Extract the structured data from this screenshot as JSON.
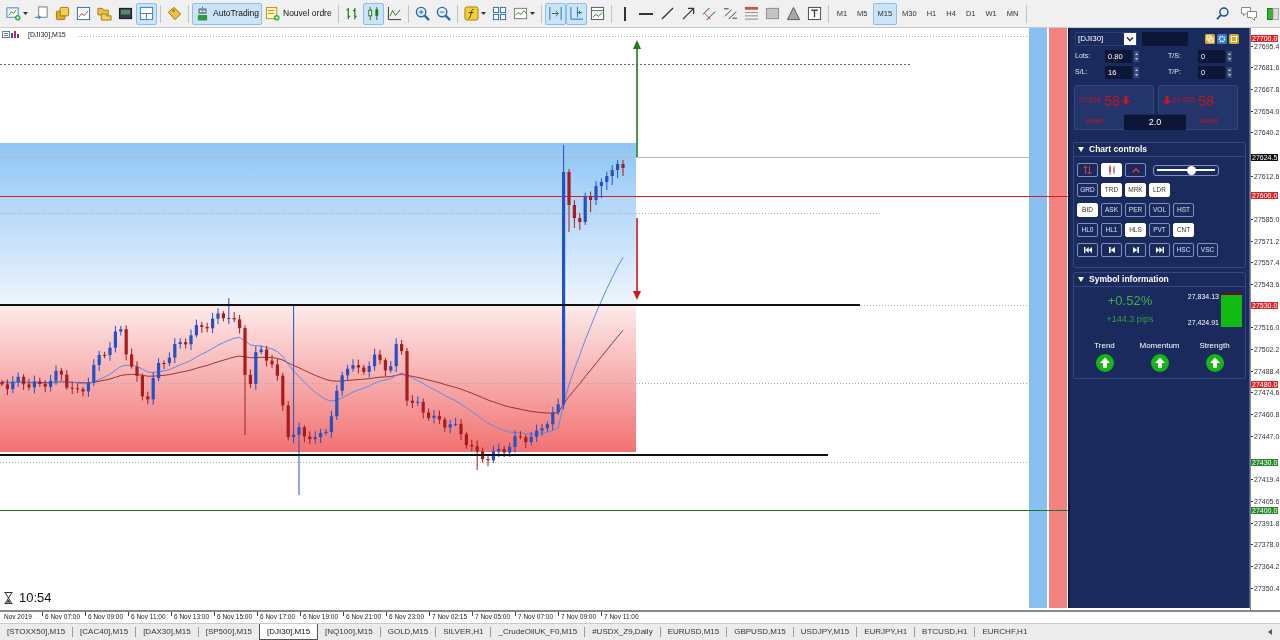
{
  "toolbar": {
    "buttons": [
      {
        "kind": "dropdown",
        "on": false
      },
      {
        "kind": "icon",
        "on": false
      },
      {
        "kind": "icon",
        "on": false
      },
      {
        "kind": "icon",
        "on": false
      },
      {
        "kind": "icon",
        "on": false
      },
      {
        "kind": "icon",
        "on": false
      },
      {
        "kind": "icon",
        "on": true
      },
      {
        "kind": "icon",
        "on": false
      },
      {
        "kind": "labeled",
        "label": "AutoTrading",
        "on": true
      },
      {
        "kind": "labeled",
        "label": "Nouvel ordre",
        "on": false
      },
      {
        "kind": "icon",
        "on": false
      },
      {
        "kind": "icon",
        "on": true
      },
      {
        "kind": "icon",
        "on": false
      },
      {
        "kind": "icon",
        "on": false
      },
      {
        "kind": "icon",
        "on": false
      },
      {
        "kind": "dropdown",
        "on": false
      },
      {
        "kind": "icon",
        "on": false
      },
      {
        "kind": "dropdown",
        "on": false
      },
      {
        "kind": "icon",
        "on": true
      },
      {
        "kind": "icon",
        "on": true
      },
      {
        "kind": "icon",
        "on": false
      },
      {
        "kind": "icon",
        "on": false
      },
      {
        "kind": "icon",
        "on": false
      },
      {
        "kind": "icon",
        "on": false
      },
      {
        "kind": "icon",
        "on": false
      },
      {
        "kind": "icon",
        "on": false
      },
      {
        "kind": "icon",
        "on": false
      },
      {
        "kind": "icon",
        "on": false
      },
      {
        "kind": "icon",
        "on": false
      },
      {
        "kind": "icon",
        "on": false
      },
      {
        "kind": "icon",
        "on": false
      }
    ],
    "timeframes": [
      {
        "label": "M1",
        "selected": false
      },
      {
        "label": "M5",
        "selected": false
      },
      {
        "label": "M15",
        "selected": true
      },
      {
        "label": "M30",
        "selected": false
      },
      {
        "label": "H1",
        "selected": false
      },
      {
        "label": "H4",
        "selected": false
      },
      {
        "label": "D1",
        "selected": false
      },
      {
        "label": "W1",
        "selected": false
      },
      {
        "label": "MN",
        "selected": false
      }
    ]
  },
  "chart": {
    "title": "[DJI30],M15",
    "clock": "10:54",
    "price_labels": [
      {
        "label": "27700.0",
        "color": "#d62828"
      },
      {
        "label": "27695.4"
      },
      {
        "label": "27681.6"
      },
      {
        "label": "27667.8"
      },
      {
        "label": "27654.0"
      },
      {
        "label": "27640.2"
      },
      {
        "label": "27624.5",
        "color": "#111111"
      },
      {
        "label": "27612.6"
      },
      {
        "label": "27600.0",
        "color": "#d62828"
      },
      {
        "label": "27585.0"
      },
      {
        "label": "27571.2"
      },
      {
        "label": "27557.4"
      },
      {
        "label": "27543.6"
      },
      {
        "label": "27530.0",
        "color": "#d62828"
      },
      {
        "label": "27516.0"
      },
      {
        "label": "27502.2"
      },
      {
        "label": "27488.4"
      },
      {
        "label": "27480.0",
        "color": "#d62828"
      },
      {
        "label": "27474.6"
      },
      {
        "label": "27460.8"
      },
      {
        "label": "27447.0"
      },
      {
        "label": "27430.0",
        "color": "#2a8a2a"
      },
      {
        "label": "27419.4"
      },
      {
        "label": "27405.6"
      },
      {
        "label": "27400.0",
        "color": "#2a8a2a"
      },
      {
        "label": "27391.8"
      },
      {
        "label": "27378.0"
      },
      {
        "label": "27364.2"
      },
      {
        "label": "27350.4"
      }
    ],
    "time_labels": [
      "Nov 2019",
      "6 Nov 07:00",
      "6 Nov 09:00",
      "6 Nov 11:00",
      "6 Nov 13:00",
      "6 Nov 15:00",
      "6 Nov 17:00",
      "6 Nov 19:00",
      "6 Nov 21:00",
      "6 Nov 23:00",
      "7 Nov 02:15",
      "7 Nov 05:00",
      "7 Nov 07:00",
      "7 Nov 09:00",
      "7 Nov 11:00"
    ]
  },
  "trade_panel": {
    "symbol": "[DJI30]",
    "fields": [
      {
        "label": "Lots:",
        "value": "0.80"
      },
      {
        "label": "T/S:",
        "value": "0"
      },
      {
        "label": "S/L:",
        "value": "16"
      },
      {
        "label": "T/P:",
        "value": "0"
      }
    ],
    "sell": {
      "price": "27,626.",
      "pips": "58",
      "label": "Vente"
    },
    "buy": {
      "price": "27,626.",
      "pips": "58",
      "label": "Achat"
    },
    "volume": "2.0"
  },
  "chart_controls": {
    "title": "Chart controls",
    "expanded": true,
    "rows": [
      [
        {
          "kind": "icon",
          "on": false
        },
        {
          "kind": "icon",
          "on": true
        },
        {
          "kind": "icon",
          "on": false
        },
        {
          "kind": "slider",
          "level": 0.6
        }
      ],
      [
        {
          "kind": "text",
          "label": "GRD",
          "on": false
        },
        {
          "kind": "text",
          "label": "TRD",
          "on": true
        },
        {
          "kind": "text",
          "label": "MRK",
          "on": true
        },
        {
          "kind": "text",
          "label": "LDR",
          "on": true
        }
      ],
      [
        {
          "kind": "text",
          "label": "BID",
          "on": true
        },
        {
          "kind": "text",
          "label": "ASK",
          "on": false
        },
        {
          "kind": "text",
          "label": "PER",
          "on": false
        },
        {
          "kind": "text",
          "label": "VOL",
          "on": false
        },
        {
          "kind": "text",
          "label": "HST",
          "on": false
        }
      ],
      [
        {
          "kind": "text",
          "label": "HL0",
          "on": false
        },
        {
          "kind": "text",
          "label": "HL1",
          "on": false
        },
        {
          "kind": "text",
          "label": "HLS",
          "on": true
        },
        {
          "kind": "text",
          "label": "PVT",
          "on": false
        },
        {
          "kind": "text",
          "label": "CNT",
          "on": true
        }
      ],
      [
        {
          "kind": "icon",
          "on": false
        },
        {
          "kind": "icon",
          "on": false
        },
        {
          "kind": "icon",
          "on": false
        },
        {
          "kind": "icon",
          "on": false
        },
        {
          "kind": "text",
          "label": "HSC",
          "on": false
        },
        {
          "kind": "text",
          "label": "VSC",
          "on": false
        }
      ]
    ]
  },
  "symbol_information": {
    "title": "Symbol information",
    "expanded": true,
    "change": "+0.52%",
    "pips": "+144.3 pips",
    "high": "27,834.13",
    "low": "27,424.91",
    "indicators": [
      {
        "label": "Trend",
        "up": true
      },
      {
        "label": "Momentum",
        "up": true
      },
      {
        "label": "Strength",
        "up": true
      }
    ]
  },
  "tabs": [
    {
      "label": "[STOXX50],M15",
      "selected": false
    },
    {
      "label": "[CAC40],M15",
      "selected": false
    },
    {
      "label": "[DAX30],M15",
      "selected": false
    },
    {
      "label": "[SP500],M15",
      "selected": false
    },
    {
      "label": "[DJI30],M15",
      "selected": true
    },
    {
      "label": "[NQ100],M15",
      "selected": false
    },
    {
      "label": "GOLD,M15",
      "selected": false
    },
    {
      "label": "SILVER,H1",
      "selected": false
    },
    {
      "label": "_CrudeOilUK_F0,M15",
      "selected": false
    },
    {
      "label": "#USDX_Z9,Daily",
      "selected": false
    },
    {
      "label": "EURUSD,M15",
      "selected": false
    },
    {
      "label": "GBPUSD,M15",
      "selected": false
    },
    {
      "label": "USDJPY,M15",
      "selected": false
    },
    {
      "label": "EURJPY,H1",
      "selected": false
    },
    {
      "label": "BTCUSD,H1",
      "selected": false
    },
    {
      "label": "EURCHF,H1",
      "selected": false
    }
  ]
}
